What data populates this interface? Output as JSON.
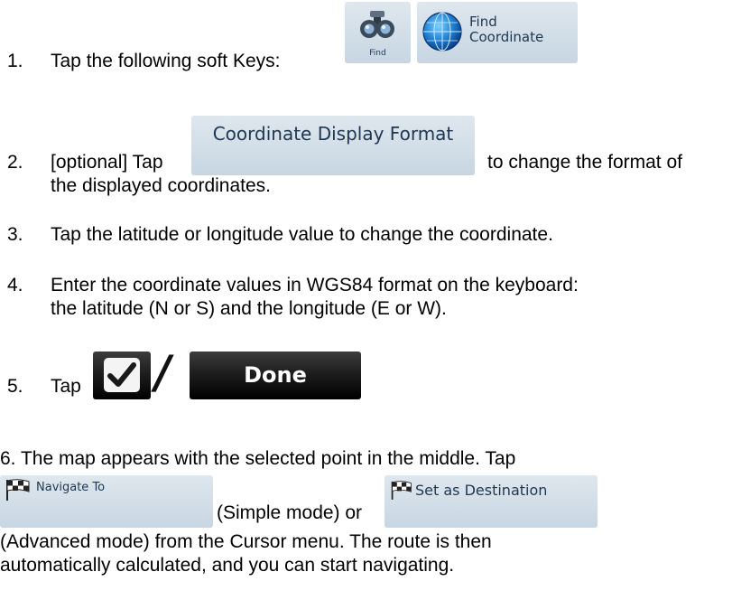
{
  "steps": {
    "s1": {
      "num": "1.",
      "text": "Tap the following soft Keys:"
    },
    "s2": {
      "num": "2.",
      "before": "[optional] Tap",
      "after": "to change the format of",
      "cont": "the displayed coordinates."
    },
    "s3": {
      "num": "3.",
      "text": "Tap the latitude or longitude value to change the coordinate."
    },
    "s4": {
      "num": "4.",
      "line1": "Enter the coordinate values in WGS84 format on the keyboard:",
      "line2": "the latitude (N or S) and the longitude (E or W)."
    },
    "s5": {
      "num": "5.",
      "text": "Tap"
    },
    "s6": {
      "line1": "6. The map appears with the selected point in the middle. Tap",
      "simple": "(Simple mode) or",
      "line3": "(Advanced mode) from the Cursor menu. The route is then",
      "line4": "automatically calculated, and you can start navigating."
    }
  },
  "buttons": {
    "find": "Find",
    "find_coordinate_1": "Find",
    "find_coordinate_2": "Coordinate",
    "coordinate_display_format": "Coordinate Display Format",
    "done": "Done",
    "slash": "/",
    "navigate_to": "Navigate To",
    "set_as_destination": "Set as Destination"
  }
}
